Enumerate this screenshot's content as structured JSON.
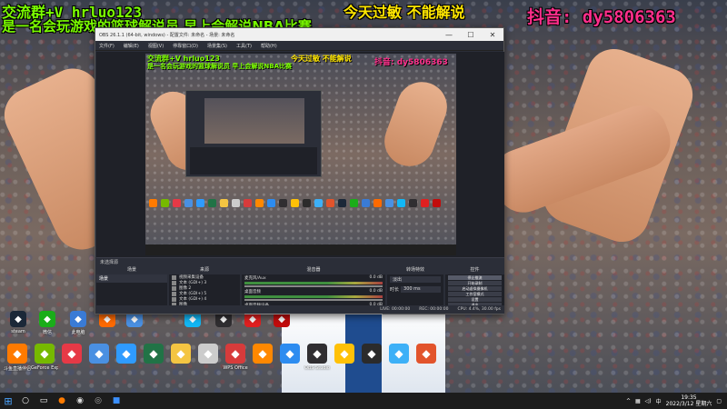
{
  "overlay": {
    "group": "交流群+V hrluo123",
    "desc": "是一名会玩游戏的篮球解说员 早上会解说NBA比赛",
    "today": "今天过敏 不能解说",
    "douyin": "抖音: dy5806363"
  },
  "obs": {
    "title": "OBS 26.1.1 (64-bit, windows) - 配置文件: 未命名 - 场景: 未命名",
    "menu": [
      "文件(F)",
      "编辑(E)",
      "视图(V)",
      "停靠窗口(D)",
      "场景集(S)",
      "工具(T)",
      "帮助(H)"
    ],
    "dock_header": "未选择源",
    "docks": {
      "scenes": "场景",
      "sources": "来源",
      "mixer": "混音器",
      "transitions": "转场特效",
      "controls": "控件"
    },
    "scene_item": "场景",
    "sources": [
      {
        "icon": "camera-icon",
        "label": "视频采集设备"
      },
      {
        "icon": "text-icon",
        "label": "文本 (GDI+) 3"
      },
      {
        "icon": "image-icon",
        "label": "图像 2"
      },
      {
        "icon": "text-icon",
        "label": "文本 (GDI+) 5"
      },
      {
        "icon": "text-icon",
        "label": "文本 (GDI+) 4"
      },
      {
        "icon": "image-icon",
        "label": "图像"
      }
    ],
    "mixer": [
      {
        "label": "麦克风/Aux",
        "db": "0.0 dB"
      },
      {
        "label": "桌面音频",
        "db": "0.0 dB"
      },
      {
        "label": "桌面音频设备",
        "db": "0.0 dB"
      }
    ],
    "transitions": {
      "type": "淡出",
      "duration_label": "时长",
      "duration": "300 ms"
    },
    "controls": [
      "停止推流",
      "开始录制",
      "启动虚拟摄像机",
      "工作室模式",
      "设置",
      "退出"
    ],
    "status": [
      "LIVE: 00:00:00",
      "REC: 00:00:00",
      "CPU: 4.4%, 30.00 fps"
    ]
  },
  "desktop_icons_row1": [
    {
      "icon": "steam-icon",
      "label": "steam",
      "color": "#1b2838"
    },
    {
      "icon": "wechat-icon",
      "label": "微信",
      "color": "#1aad19"
    },
    {
      "icon": "computer-icon",
      "label": "此电脑",
      "color": "#3a7bd5"
    },
    {
      "icon": "game-icon",
      "label": "",
      "color": "#ff6a00"
    },
    {
      "icon": "network-icon",
      "label": "",
      "color": "#4a90e2"
    },
    {
      "icon": "qq-icon",
      "label": "",
      "color": "#12b7f5"
    },
    {
      "icon": "obs-icon",
      "label": "",
      "color": "#302e31"
    },
    {
      "icon": "live-icon",
      "label": "",
      "color": "#e02020"
    },
    {
      "icon": "netease-icon",
      "label": "",
      "color": "#c20c0c"
    }
  ],
  "desktop_icons_row2": [
    {
      "icon": "live-assistant-icon",
      "label": "斗鱼直播伴侣",
      "color": "#ff7a00"
    },
    {
      "icon": "geforce-icon",
      "label": "GeForce Experience",
      "color": "#76b900"
    },
    {
      "icon": "voice-icon",
      "label": "",
      "color": "#e63946"
    },
    {
      "icon": "recycle-icon",
      "label": "",
      "color": "#4a90e2"
    },
    {
      "icon": "kugou-icon",
      "label": "",
      "color": "#2f9bff"
    },
    {
      "icon": "excel-icon",
      "label": "",
      "color": "#217346"
    },
    {
      "icon": "folder-icon",
      "label": "",
      "color": "#f4c542"
    },
    {
      "icon": "file-icon",
      "label": "",
      "color": "#cccccc"
    },
    {
      "icon": "wps-icon",
      "label": "WPS Office",
      "color": "#d73b3b"
    },
    {
      "icon": "game2-icon",
      "label": "",
      "color": "#ff8800"
    },
    {
      "icon": "media-icon",
      "label": "",
      "color": "#2d8cf0"
    },
    {
      "icon": "obs2-icon",
      "label": "OBS Studio",
      "color": "#302e31"
    },
    {
      "icon": "tv-icon",
      "label": "",
      "color": "#ffc107"
    },
    {
      "icon": "steam2-icon",
      "label": "",
      "color": "#2b2b2b"
    },
    {
      "icon": "cloud-icon",
      "label": "",
      "color": "#3db0f7"
    },
    {
      "icon": "app-icon",
      "label": "",
      "color": "#e2542c"
    }
  ],
  "taskbar": {
    "clock_time": "19:35",
    "clock_date": "2022/3/12 星期六"
  },
  "colors": {
    "overlay_green": "#7cff00",
    "overlay_yellow": "#ffe600",
    "overlay_pink": "#ff2e8b"
  }
}
